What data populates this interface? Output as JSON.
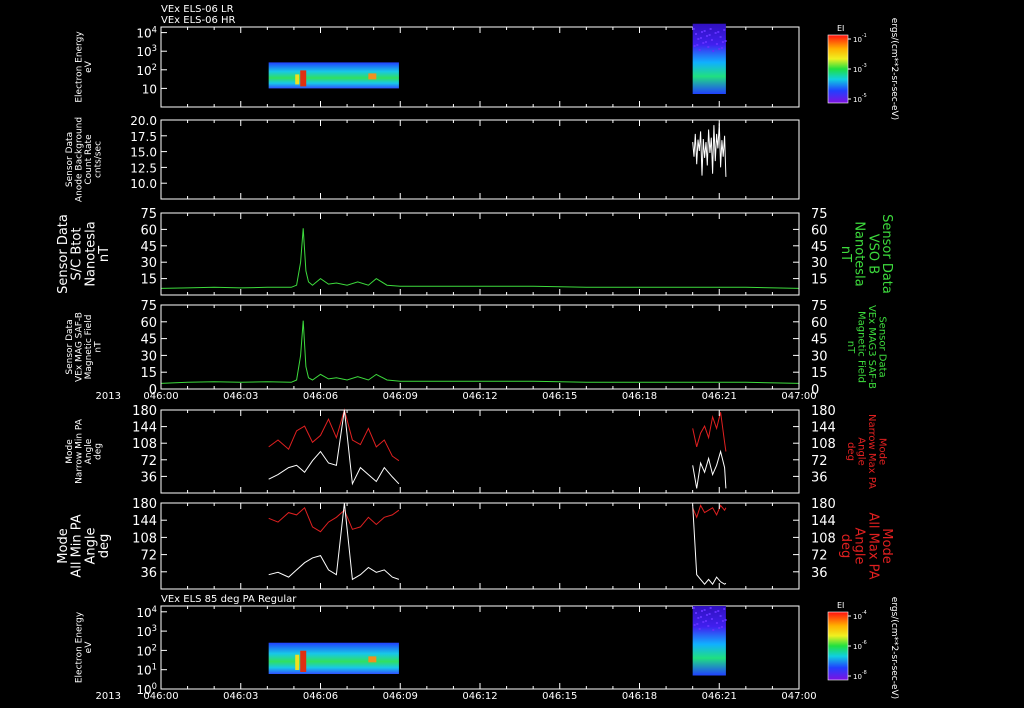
{
  "chart_data": [
    {
      "type": "heatmap",
      "id": "els_hr",
      "header_lines": [
        "VEx ELS-06 LR",
        "VEx ELS-06 HR"
      ],
      "ylabel": [
        "Electron Energy",
        "eV"
      ],
      "yscale": "log",
      "ylim": [
        1,
        20000
      ],
      "yticks": [
        "10",
        "10^2",
        "10^3",
        "10^4"
      ],
      "colorbar": {
        "label": "EI",
        "ticks": [
          "10^-1",
          "10^-3",
          "10^-5"
        ],
        "units": "ergs/(cm**2-sr-sec-eV)"
      },
      "blocks": [
        {
          "start": "046:04.05",
          "end": "046:08.95",
          "low": 10,
          "high": 250
        },
        {
          "start": "046:20.00",
          "end": "046:21.25",
          "low": 5,
          "high": 30000
        }
      ]
    },
    {
      "type": "line",
      "id": "anode_bg",
      "ylabel": [
        "Sensor Data",
        "Anode Background",
        "Count Rate",
        "cnts/sec"
      ],
      "ylim": [
        7.5,
        20.0
      ],
      "yticks": [
        "10.0",
        "12.5",
        "15.0",
        "17.5",
        "20.0"
      ],
      "series": [
        {
          "color": "#ffffff",
          "x": [
            "046:20.00",
            "046:20.05",
            "046:20.10",
            "046:20.15",
            "046:20.20",
            "046:20.25",
            "046:20.30",
            "046:20.35",
            "046:20.40",
            "046:20.45",
            "046:20.50",
            "046:20.55",
            "046:20.60",
            "046:20.65",
            "046:20.70",
            "046:20.75",
            "046:20.80",
            "046:20.85",
            "046:20.90",
            "046:20.95",
            "046:21.00",
            "046:21.05",
            "046:21.10",
            "046:21.15",
            "046:21.20",
            "046:21.25"
          ],
          "y": [
            16.5,
            14.2,
            17.8,
            13.0,
            16.9,
            15.1,
            18.2,
            11.2,
            17.0,
            14.0,
            16.5,
            12.8,
            18.5,
            14.8,
            17.2,
            11.5,
            19.2,
            13.5,
            17.8,
            15.5,
            19.5,
            12.5,
            16.8,
            14.2,
            17.5,
            11.0
          ]
        }
      ]
    },
    {
      "type": "line",
      "id": "sc_bmag",
      "ylabel": [
        "Sensor Data",
        "S/C Btot",
        "Nanotesla",
        "nT"
      ],
      "ylabel_right": [
        "Sensor Data",
        "VSO B",
        "Nanotesla",
        "nT"
      ],
      "ylim": [
        0,
        75
      ],
      "yticks": [
        "15",
        "30",
        "45",
        "60",
        "75"
      ],
      "series": [
        {
          "color": "#3ddb3d",
          "x": [
            "046:00.00",
            "046:01.00",
            "046:02.00",
            "046:03.00",
            "046:04.00",
            "046:04.90",
            "046:05.10",
            "046:05.25",
            "046:05.35",
            "046:05.45",
            "046:05.55",
            "046:05.70",
            "046:06.00",
            "046:06.30",
            "046:06.60",
            "046:07.00",
            "046:07.40",
            "046:07.80",
            "046:08.10",
            "046:08.50",
            "046:09.00",
            "046:10.00",
            "046:12.00",
            "046:14.00",
            "046:16.00",
            "046:18.00",
            "046:20.00",
            "046:22.00",
            "046:24.00"
          ],
          "y": [
            6,
            6.5,
            7,
            6.5,
            7,
            7,
            9,
            30,
            61,
            22,
            12,
            9,
            15,
            10,
            11,
            9,
            12,
            9,
            15,
            9,
            8,
            8,
            8,
            8,
            7,
            7,
            7,
            7,
            6
          ]
        }
      ]
    },
    {
      "type": "line",
      "id": "mag_saf",
      "ylabel": [
        "Sensor Data",
        "VEx MAG SAF-B",
        "Magnetic Field",
        "nT"
      ],
      "ylabel_right": [
        "Sensor Data",
        "VEx MAG3 SAF-B",
        "Magnetic Field",
        "nT"
      ],
      "ylim": [
        0,
        75
      ],
      "yticks": [
        "0",
        "15",
        "30",
        "45",
        "60",
        "75"
      ],
      "series": [
        {
          "color": "#3ddb3d",
          "x": [
            "046:00.00",
            "046:01.00",
            "046:02.00",
            "046:03.00",
            "046:04.00",
            "046:04.90",
            "046:05.10",
            "046:05.25",
            "046:05.35",
            "046:05.45",
            "046:05.55",
            "046:05.70",
            "046:06.00",
            "046:06.30",
            "046:06.60",
            "046:07.00",
            "046:07.40",
            "046:07.80",
            "046:08.10",
            "046:08.50",
            "046:09.00",
            "046:10.00",
            "046:12.00",
            "046:14.00",
            "046:16.00",
            "046:18.00",
            "046:20.00",
            "046:22.00",
            "046:24.00"
          ],
          "y": [
            5,
            6,
            6.5,
            6,
            6.5,
            6,
            8,
            30,
            61,
            20,
            10,
            8,
            13,
            9,
            10,
            8,
            11,
            8,
            13,
            8,
            7,
            7,
            7,
            7,
            6,
            6,
            6,
            6,
            5
          ]
        }
      ]
    },
    {
      "type": "line",
      "id": "narrow_pa",
      "ylabel": [
        "Mode",
        "Narrow Min PA",
        "Angle",
        "deg"
      ],
      "ylabel_right": [
        "Mode",
        "Narrow Max PA",
        "Angle",
        "deg"
      ],
      "ylim": [
        0,
        180
      ],
      "yticks": [
        "36",
        "72",
        "108",
        "144",
        "180"
      ],
      "series": [
        {
          "name": "Max",
          "color": "#e02020",
          "x": [
            "046:04.05",
            "046:04.40",
            "046:04.80",
            "046:05.10",
            "046:05.40",
            "046:05.70",
            "046:06.00",
            "046:06.30",
            "046:06.60",
            "046:06.90",
            "046:07.20",
            "046:07.50",
            "046:07.80",
            "046:08.10",
            "046:08.40",
            "046:08.70",
            "046:08.95"
          ],
          "y": [
            100,
            115,
            95,
            135,
            145,
            110,
            125,
            160,
            120,
            180,
            115,
            105,
            140,
            100,
            115,
            80,
            70
          ]
        },
        {
          "name": "Min",
          "color": "#ffffff",
          "x": [
            "046:04.05",
            "046:04.40",
            "046:04.80",
            "046:05.10",
            "046:05.40",
            "046:05.70",
            "046:06.00",
            "046:06.30",
            "046:06.60",
            "046:06.90",
            "046:07.20",
            "046:07.50",
            "046:07.80",
            "046:08.10",
            "046:08.40",
            "046:08.70",
            "046:08.95"
          ],
          "y": [
            30,
            40,
            55,
            60,
            45,
            70,
            90,
            65,
            60,
            180,
            20,
            55,
            40,
            25,
            55,
            35,
            20
          ]
        },
        {
          "name": "Max",
          "color": "#e02020",
          "x": [
            "046:20.00",
            "046:20.15",
            "046:20.30",
            "046:20.45",
            "046:20.60",
            "046:20.75",
            "046:20.90",
            "046:21.05",
            "046:21.20",
            "046:21.25"
          ],
          "y": [
            140,
            100,
            130,
            145,
            120,
            165,
            140,
            175,
            110,
            90
          ]
        },
        {
          "name": "Min",
          "color": "#ffffff",
          "x": [
            "046:20.00",
            "046:20.15",
            "046:20.30",
            "046:20.45",
            "046:20.60",
            "046:20.75",
            "046:20.90",
            "046:21.05",
            "046:21.20",
            "046:21.25"
          ],
          "y": [
            60,
            10,
            65,
            45,
            75,
            40,
            60,
            90,
            55,
            10
          ]
        }
      ]
    },
    {
      "type": "line",
      "id": "all_pa",
      "ylabel": [
        "Mode",
        "All Min PA",
        "Angle",
        "deg"
      ],
      "ylabel_right": [
        "Mode",
        "All Max PA",
        "Angle",
        "deg"
      ],
      "ylim": [
        0,
        180
      ],
      "yticks": [
        "36",
        "72",
        "108",
        "144",
        "180"
      ],
      "series": [
        {
          "name": "Max",
          "color": "#e02020",
          "x": [
            "046:04.05",
            "046:04.40",
            "046:04.80",
            "046:05.10",
            "046:05.40",
            "046:05.70",
            "046:06.00",
            "046:06.30",
            "046:06.60",
            "046:06.90",
            "046:07.20",
            "046:07.50",
            "046:07.80",
            "046:08.10",
            "046:08.40",
            "046:08.70",
            "046:08.95"
          ],
          "y": [
            148,
            140,
            160,
            155,
            170,
            130,
            120,
            140,
            150,
            165,
            125,
            130,
            150,
            135,
            150,
            155,
            165
          ]
        },
        {
          "name": "Min",
          "color": "#ffffff",
          "x": [
            "046:04.05",
            "046:04.40",
            "046:04.80",
            "046:05.10",
            "046:05.40",
            "046:05.70",
            "046:06.00",
            "046:06.30",
            "046:06.60",
            "046:06.90",
            "046:07.20",
            "046:07.50",
            "046:07.80",
            "046:08.10",
            "046:08.40",
            "046:08.70",
            "046:08.95"
          ],
          "y": [
            30,
            35,
            25,
            40,
            55,
            65,
            70,
            40,
            30,
            180,
            20,
            30,
            45,
            35,
            40,
            25,
            20
          ]
        },
        {
          "name": "Max",
          "color": "#e02020",
          "x": [
            "046:20.00",
            "046:20.15",
            "046:20.30",
            "046:20.45",
            "046:20.60",
            "046:20.75",
            "046:20.90",
            "046:21.05",
            "046:21.20",
            "046:21.25"
          ],
          "y": [
            170,
            150,
            175,
            160,
            165,
            170,
            155,
            175,
            165,
            170
          ]
        },
        {
          "name": "Min",
          "color": "#ffffff",
          "x": [
            "046:20.00",
            "046:20.15",
            "046:20.30",
            "046:20.45",
            "046:20.60",
            "046:20.75",
            "046:20.90",
            "046:21.05",
            "046:21.20",
            "046:21.25"
          ],
          "y": [
            175,
            30,
            20,
            10,
            20,
            10,
            25,
            15,
            10,
            12
          ]
        }
      ]
    },
    {
      "type": "heatmap",
      "id": "els_85deg",
      "header_lines": [
        "VEx ELS 85 deg PA Regular"
      ],
      "ylabel": [
        "Electron Energy",
        "eV"
      ],
      "yscale": "log",
      "ylim": [
        1,
        20000
      ],
      "yticks": [
        "10^0",
        "10^1",
        "10^2",
        "10^3",
        "10^4"
      ],
      "colorbar": {
        "label": "EI",
        "ticks": [
          "10^-4",
          "10^-6",
          "10^-8"
        ],
        "units": "ergs/(cm**2-sr-sec-eV)"
      },
      "blocks": [
        {
          "start": "046:04.05",
          "end": "046:08.95",
          "low": 6,
          "high": 250
        },
        {
          "start": "046:20.00",
          "end": "046:21.25",
          "low": 5,
          "high": 20000
        }
      ]
    }
  ],
  "time_axis": {
    "year": "2013",
    "ticks": [
      "046:00",
      "046:03",
      "046:06",
      "046:09",
      "046:12",
      "046:15",
      "046:18",
      "046:21",
      "047:00"
    ]
  }
}
